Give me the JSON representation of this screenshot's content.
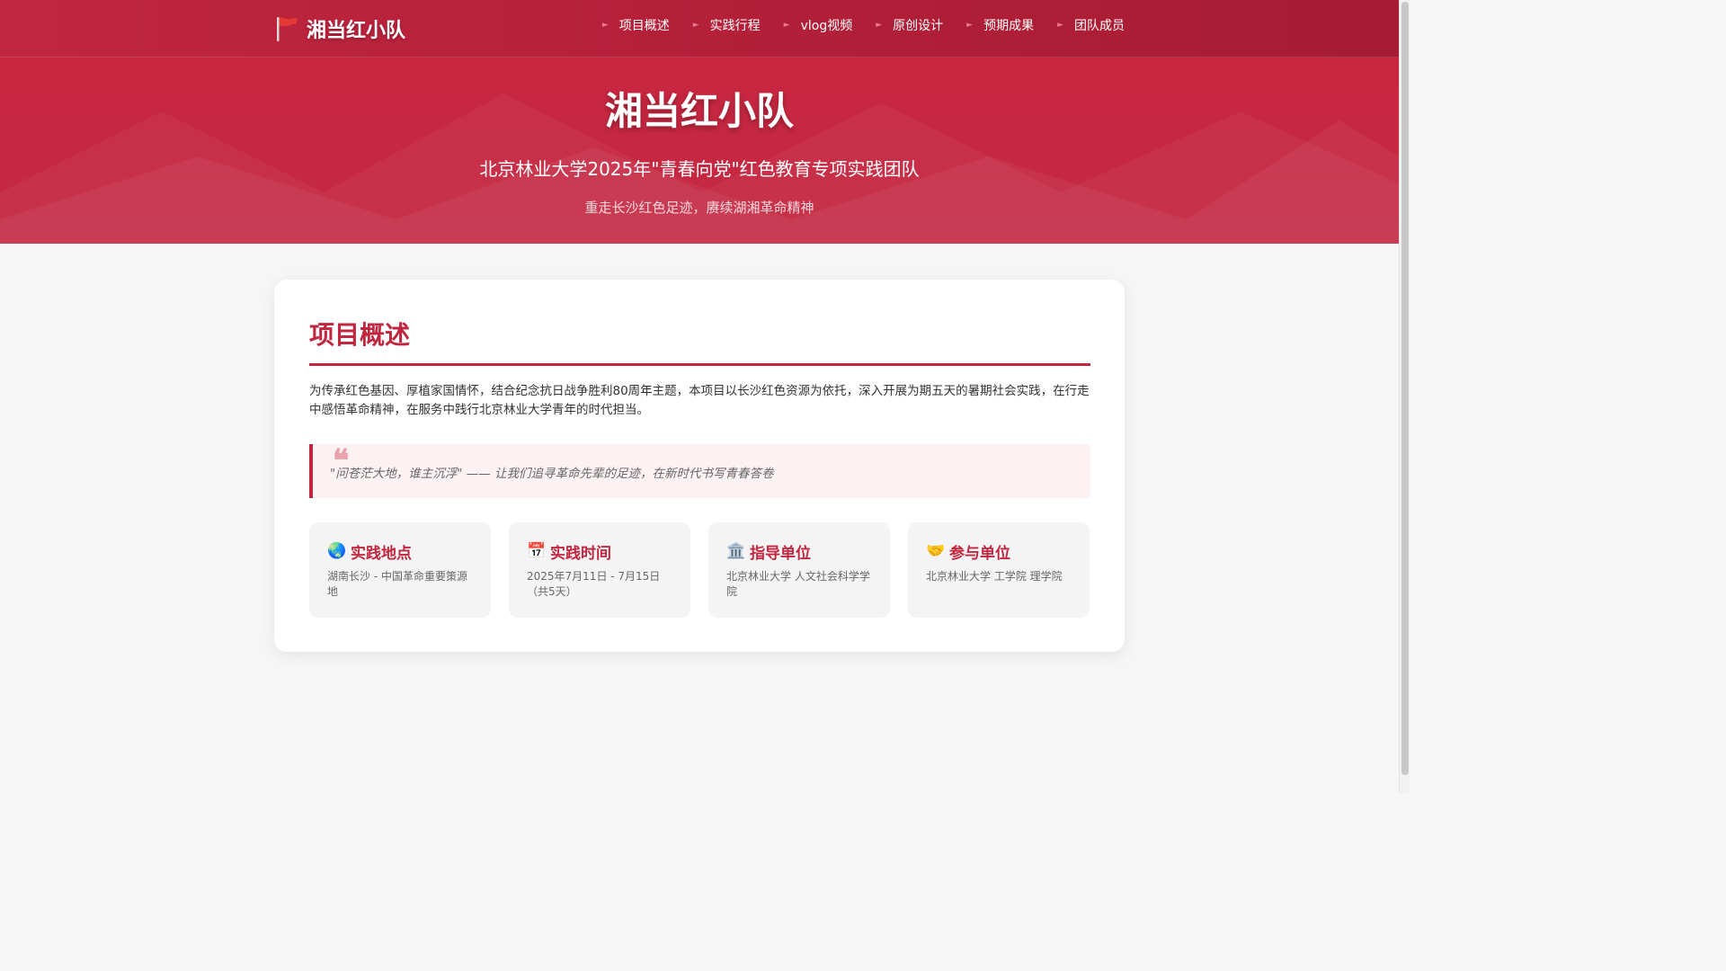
{
  "navbar": {
    "brand": "湘当红小队",
    "items": [
      {
        "label": "项目概述"
      },
      {
        "label": "实践行程"
      },
      {
        "label": "vlog视频"
      },
      {
        "label": "原创设计"
      },
      {
        "label": "预期成果"
      },
      {
        "label": "团队成员"
      }
    ],
    "bullet": "►"
  },
  "hero": {
    "title": "湘当红小队",
    "subtitle": "北京林业大学2025年\"青春向党\"红色教育专项实践团队",
    "tagline": "重走长沙红色足迹，赓续湖湘革命精神"
  },
  "overview": {
    "title": "项目概述",
    "intro": "为传承红色基因、厚植家国情怀，结合纪念抗日战争胜利80周年主题，本项目以长沙红色资源为依托，深入开展为期五天的暑期社会实践，在行走中感悟革命精神，在服务中践行北京林业大学青年的时代担当。",
    "quote_mark": "❝",
    "quote": "\"问苍茫大地，谁主沉浮\" —— 让我们追寻革命先辈的足迹，在新时代书写青春答卷",
    "cards": [
      {
        "icon": "🌏",
        "title": "实践地点",
        "desc": "湖南长沙 - 中国革命重要策源地"
      },
      {
        "icon": "📅",
        "title": "实践时间",
        "desc": "2025年7月11日 - 7月15日（共5天）"
      },
      {
        "icon": "🏛️",
        "title": "指导单位",
        "desc": "北京林业大学 人文社会科学学院"
      },
      {
        "icon": "🤝",
        "title": "参与单位",
        "desc": "北京林业大学 工学院 理学院"
      }
    ]
  },
  "colors": {
    "primary": "#c1263f",
    "quote_bg": "#fcf2f3",
    "card_bg": "#f4f4f4"
  }
}
